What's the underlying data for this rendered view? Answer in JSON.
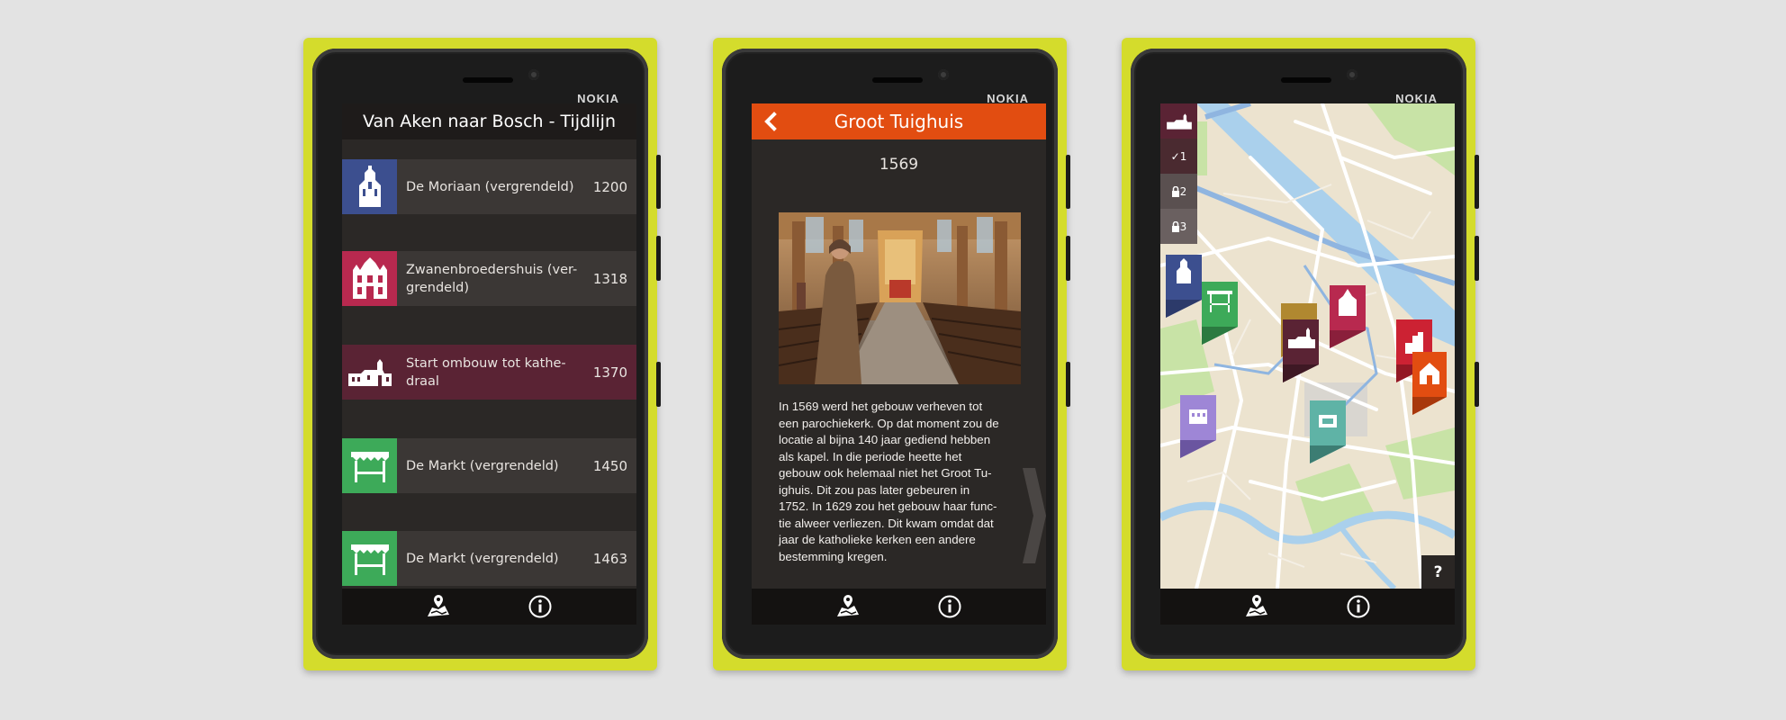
{
  "phones": [
    {
      "brand": "NOKIA"
    },
    {
      "brand": "NOKIA"
    },
    {
      "brand": "NOKIA"
    }
  ],
  "timeline": {
    "title": "Van Aken naar Bosch - Tijdlijn",
    "items": [
      {
        "label": "De Moriaan (vergrendeld)",
        "year": "1200",
        "color": "#3c4f8f",
        "icon": "tower-building-icon"
      },
      {
        "label": "Zwanenbroedershuis (ver-grendeld)",
        "year": "1318",
        "color": "#b8294f",
        "icon": "guildhall-icon"
      },
      {
        "label": "Start ombouw tot kathe-draal",
        "year": "1370",
        "color": "#5a2334",
        "icon": "cathedral-icon"
      },
      {
        "label": "De Markt (vergrendeld)",
        "year": "1450",
        "color": "#3daa59",
        "icon": "market-stall-icon"
      },
      {
        "label": "De Markt (vergrendeld)",
        "year": "1463",
        "color": "#3daa59",
        "icon": "market-stall-icon"
      }
    ]
  },
  "detail": {
    "title": "Groot Tuighuis",
    "year": "1569",
    "text_lines": [
      "In 1569 werd het gebouw verheven tot",
      "een parochiekerk. Op dat moment zou de",
      "locatie al bijna 140 jaar gediend hebben",
      "als kapel. In die periode heette het",
      "gebouw ook helemaal niet het Groot Tu-",
      "ighuis. Dit zou pas later gebeuren in",
      "1752. In 1629 zou het gebouw haar func-",
      "tie alweer verliezen. Dit kwam omdat dat",
      "jaar de katholieke kerken een andere",
      "bestemming kregen."
    ],
    "accent": "#e24d11"
  },
  "map": {
    "tabs": [
      {
        "label": "",
        "icon": "cathedral-icon"
      },
      {
        "label": "✓1",
        "icon": ""
      },
      {
        "label": "2",
        "icon": "lock-icon"
      },
      {
        "label": "3",
        "icon": "lock-icon"
      }
    ],
    "help": "?"
  },
  "appbar": {
    "map_icon": "map-pin-icon",
    "info_icon": "info-icon"
  }
}
